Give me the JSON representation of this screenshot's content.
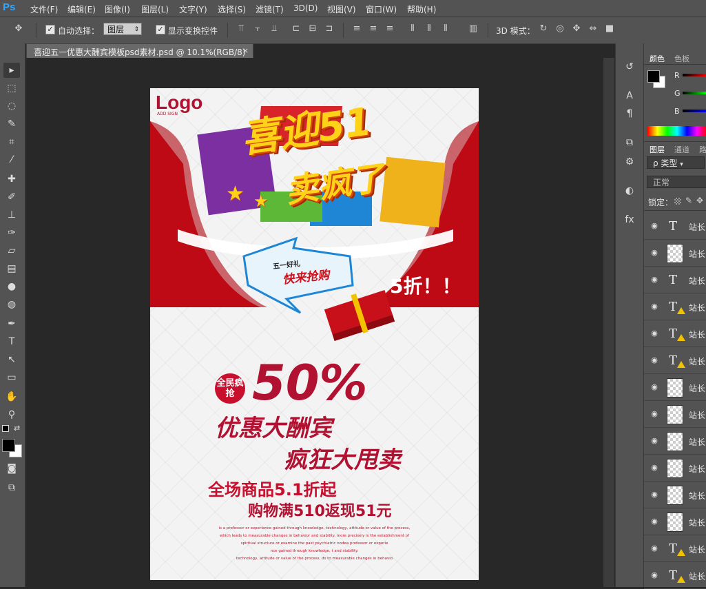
{
  "app": {
    "logo": "Ps"
  },
  "menu": [
    "文件(F)",
    "编辑(E)",
    "图像(I)",
    "图层(L)",
    "文字(Y)",
    "选择(S)",
    "滤镜(T)",
    "3D(D)",
    "视图(V)",
    "窗口(W)",
    "帮助(H)"
  ],
  "options": {
    "auto_select_label": "自动选择：",
    "auto_select_target": "图层",
    "show_transform_label": "显示变换控件",
    "mode_3d_label": "3D 模式："
  },
  "document": {
    "tab_title": "喜迎五一优惠大酬宾模板psd素材.psd @ 10.1%(RGB/8)",
    "close": "×"
  },
  "poster": {
    "logo": "Logo",
    "logo_sub": "ADD SIGN",
    "headline_1": "喜迎51",
    "headline_2": "卖疯了",
    "bubble_line1": "五一好礼",
    "bubble_line2": "快来抢购",
    "discount_tag": "5折！！",
    "seal": "全民疯抢",
    "percent": "50%",
    "line_1": "优惠大酬宾",
    "line_2": "疯狂大甩卖",
    "line_3": "全场商品5.1折起",
    "line_4": "购物满510返现51元",
    "fine_print": [
      "is a professor or experience gained through knowledge, technology, attitude or value of the process,",
      "which leads to measurable changes in behavior and stability. more precisely is the establishment of",
      "spiritual structure or examine the past psychiatric nodea professor or experie",
      "nce gained through knowledge,  t and stability.",
      "technology, attitude or value of the process, ds to measurable changes in behavio"
    ]
  },
  "panels": {
    "color_tabs": [
      "颜色",
      "色板"
    ],
    "rgb_labels": [
      "R",
      "G",
      "B"
    ],
    "layer_tabs": [
      "图层",
      "通道",
      "路"
    ],
    "kind_filter": "ρ 类型",
    "blend_mode": "正常",
    "lock_label": "锁定：",
    "layers": [
      {
        "name": "站长",
        "type": "text",
        "warn": false
      },
      {
        "name": "站长",
        "type": "pixel",
        "warn": false
      },
      {
        "name": "站长",
        "type": "text",
        "warn": false
      },
      {
        "name": "站长",
        "type": "text",
        "warn": true
      },
      {
        "name": "站长",
        "type": "text",
        "warn": true
      },
      {
        "name": "站长",
        "type": "text",
        "warn": true
      },
      {
        "name": "站长",
        "type": "pixel",
        "warn": false
      },
      {
        "name": "站长",
        "type": "pixel",
        "warn": false
      },
      {
        "name": "站长",
        "type": "pixel",
        "warn": false
      },
      {
        "name": "站长",
        "type": "pixel",
        "warn": false
      },
      {
        "name": "站长",
        "type": "pixel",
        "warn": false
      },
      {
        "name": "站长",
        "type": "pixel",
        "warn": false
      },
      {
        "name": "站长",
        "type": "text",
        "warn": true
      },
      {
        "name": "站长",
        "type": "text",
        "warn": true
      }
    ]
  },
  "colors": {
    "ui_bg": "#535353",
    "canvas_bg": "#282828",
    "accent_red": "#d0101a",
    "headline_yellow": "#ffd21a",
    "text_red": "#c8102e"
  }
}
